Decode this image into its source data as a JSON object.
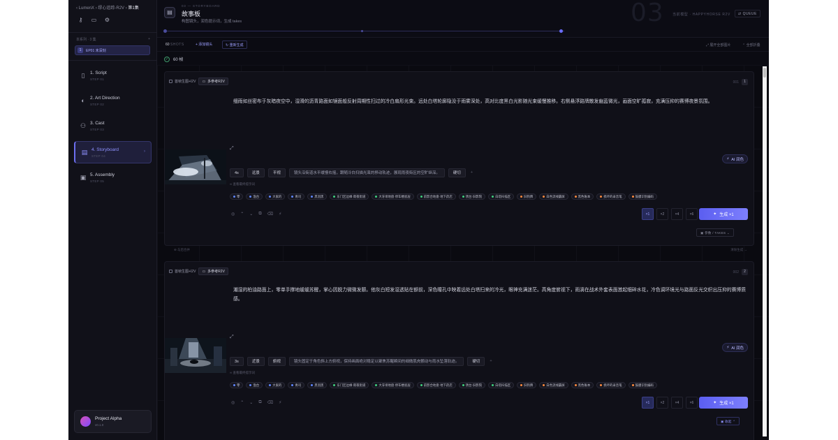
{
  "sidebar": {
    "breadcrumb": [
      "LumenX",
      "缪心追踪-R2V",
      "第1集"
    ],
    "series_label": "本系列 · 3 集",
    "episode": {
      "num": "1",
      "label": "EP01 未深刻"
    },
    "nav": [
      {
        "label": "1. Script",
        "step": "STEP 01",
        "icon": "script-icon"
      },
      {
        "label": "2. Art Direction",
        "step": "STEP 02",
        "icon": "palette-icon"
      },
      {
        "label": "3. Cast",
        "step": "STEP 03",
        "icon": "users-icon"
      },
      {
        "label": "4. Storyboard",
        "step": "STEP 04",
        "icon": "clapboard-icon"
      },
      {
        "label": "5. Assembly",
        "step": "STEP 05",
        "icon": "film-icon"
      }
    ],
    "project": {
      "name": "Project Alpha",
      "version": "v0.1.0"
    }
  },
  "header": {
    "kicker": "03 — STORYBOARD",
    "title": "故事板",
    "subtitle": "构图镜头，润色提示词，生成 takes",
    "big_step": "03",
    "model": "当前模型 · HAPPYHORSE R2V",
    "queue": "QUEUE"
  },
  "toolbar": {
    "count": "60",
    "count_unit": "SHOTS",
    "add_shot": "+ 添加镜头",
    "regen": "重新生成",
    "expand_all": "展开全部图片",
    "collapse_all": "全部折叠",
    "duration": "60 帧"
  },
  "cards": [
    {
      "mode_a": "首帧生图+I2V",
      "mode_b": "多参考R2V",
      "shot_id": "001",
      "shot_num": "1",
      "description": "细雨如丝密布于灰暗夜空中，湿滑的沥青路面如镜面般反射周期性扫过的冷白扇形光束。远处白塔轮廓隐没于雨雾深处，高对比度黑白光影随光束缓慢推移。右侧悬浮路牌散发幽蓝微光，画面空旷孤寂，充满压抑的赛博夜景氛围。",
      "duration": "4s",
      "shot_size": "远景",
      "angle": "平视",
      "motion": "镜头沿街道水平缓慢右摇，跟随冷白扫描光束的移动轨迹，展现雨夜街区的空旷纵深。",
      "transition": "硬切",
      "ref_note": "∞ 查看最终提示词",
      "tags": [
        {
          "label": "零",
          "color": "#5f86ff"
        },
        {
          "label": "渔台",
          "color": "#5f86ff"
        },
        {
          "label": "大家的",
          "color": "#5f86ff"
        },
        {
          "label": "青司",
          "color": "#5f86ff"
        },
        {
          "label": "黑羽黑",
          "color": "#5f86ff"
        },
        {
          "label": "东门区边缘·雨夜街道",
          "color": "#3fcf7e"
        },
        {
          "label": "大牙坝地盘·停车楼底层",
          "color": "#3fcf7e"
        },
        {
          "label": "前影合地盘·地下药店",
          "color": "#3fcf7e"
        },
        {
          "label": "锈台·旧影院",
          "color": "#3fcf7e"
        },
        {
          "label": "白塔扫描区",
          "color": "#3fcf7e"
        },
        {
          "label": "旧狗牌",
          "color": "#ff8a3d"
        },
        {
          "label": "白色流线霸屏",
          "color": "#ff8a3d"
        },
        {
          "label": "黑色账本",
          "color": "#ff8a3d"
        },
        {
          "label": "损坏的录音笔",
          "color": "#ff8a3d"
        },
        {
          "label": "鼓膜识别编码",
          "color": "#ff8a3d"
        }
      ],
      "ai_label": "AI 润色",
      "takes": [
        "×1",
        "×2",
        "×4",
        "×6"
      ],
      "generate": "生成 ×1",
      "params_takes": "参数 / TAKES"
    },
    {
      "mode_a": "首帧生图+I2V",
      "mode_b": "多参考R2V",
      "shot_id": "002",
      "shot_num": "2",
      "description": "潮湿的柏油路面上，零单手撑地缓缓苏醒，掌心因脱力微微发颤。他灰白短发湿透贴在额前，深色瞳孔中映着远处白塔扫来的冷光，眼神充满迷茫。高角度俯视下，雨滴在战术外套表面激起细碎水花，冷色调环境光与路面反光交织出压抑的赛博质感。",
      "duration": "3s",
      "shot_size": "近景",
      "angle": "俯视",
      "motion": "镜头固定于角色斜上方俯视，保持画面绝对稳定以聚焦苏醒瞬间的细微肌肉颤动与雨水坠落轨迹。",
      "transition": "硬切",
      "ref_note": "∞ 查看最终提示词",
      "tags": [
        {
          "label": "零",
          "color": "#5f86ff"
        },
        {
          "label": "渔台",
          "color": "#5f86ff"
        },
        {
          "label": "大家的",
          "color": "#5f86ff"
        },
        {
          "label": "青司",
          "color": "#5f86ff"
        },
        {
          "label": "黑羽黑",
          "color": "#5f86ff"
        },
        {
          "label": "东门区边缘·雨夜街道",
          "color": "#3fcf7e"
        },
        {
          "label": "大牙坝地盘·停车楼底层",
          "color": "#3fcf7e"
        },
        {
          "label": "前影合地盘·地下药店",
          "color": "#3fcf7e"
        },
        {
          "label": "锈台·旧影院",
          "color": "#3fcf7e"
        },
        {
          "label": "白塔扫描区",
          "color": "#3fcf7e"
        },
        {
          "label": "旧狗牌",
          "color": "#ff8a3d"
        },
        {
          "label": "白色流线霸屏",
          "color": "#ff8a3d"
        },
        {
          "label": "黑色账本",
          "color": "#ff8a3d"
        },
        {
          "label": "损坏的录音笔",
          "color": "#ff8a3d"
        },
        {
          "label": "鼓膜识别编码",
          "color": "#ff8a3d"
        }
      ],
      "ai_label": "AI 润色",
      "takes": [
        "×1",
        "×2",
        "×4",
        "×6"
      ],
      "generate": "生成 ×1",
      "params_takes": "收起"
    }
  ],
  "between": {
    "left": "⊕ 与后合并",
    "right": "清除生成 →"
  }
}
